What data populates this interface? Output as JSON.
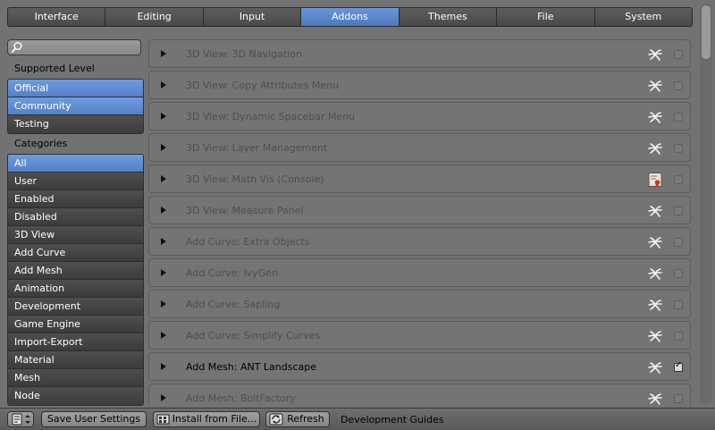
{
  "tabs": [
    "Interface",
    "Editing",
    "Input",
    "Addons",
    "Themes",
    "File",
    "System"
  ],
  "active_tab": "Addons",
  "search": {
    "placeholder": ""
  },
  "supported_level": {
    "label": "Supported Level",
    "items": [
      {
        "label": "Official",
        "selected": true
      },
      {
        "label": "Community",
        "selected": true
      },
      {
        "label": "Testing",
        "selected": false
      }
    ]
  },
  "categories": {
    "label": "Categories",
    "items": [
      {
        "label": "All",
        "selected": true
      },
      {
        "label": "User",
        "selected": false
      },
      {
        "label": "Enabled",
        "selected": false
      },
      {
        "label": "Disabled",
        "selected": false
      },
      {
        "label": "3D View",
        "selected": false
      },
      {
        "label": "Add Curve",
        "selected": false
      },
      {
        "label": "Add Mesh",
        "selected": false
      },
      {
        "label": "Animation",
        "selected": false
      },
      {
        "label": "Development",
        "selected": false
      },
      {
        "label": "Game Engine",
        "selected": false
      },
      {
        "label": "Import-Export",
        "selected": false
      },
      {
        "label": "Material",
        "selected": false
      },
      {
        "label": "Mesh",
        "selected": false
      },
      {
        "label": "Node",
        "selected": false
      }
    ]
  },
  "addons": [
    {
      "name": "3D View: 3D Navigation",
      "icon": "community-icon",
      "enabled": false
    },
    {
      "name": "3D View: Copy Attributes Menu",
      "icon": "community-icon",
      "enabled": false
    },
    {
      "name": "3D View: Dynamic Spacebar Menu",
      "icon": "community-icon",
      "enabled": false
    },
    {
      "name": "3D View: Layer Management",
      "icon": "community-icon",
      "enabled": false
    },
    {
      "name": "3D View: Math Vis (Console)",
      "icon": "official-icon",
      "enabled": false
    },
    {
      "name": "3D View: Measure Panel",
      "icon": "community-icon",
      "enabled": false
    },
    {
      "name": "Add Curve: Extra Objects",
      "icon": "community-icon",
      "enabled": false
    },
    {
      "name": "Add Curve: IvyGen",
      "icon": "community-icon",
      "enabled": false
    },
    {
      "name": "Add Curve: Sapling",
      "icon": "community-icon",
      "enabled": false
    },
    {
      "name": "Add Curve: Simplify Curves",
      "icon": "community-icon",
      "enabled": false
    },
    {
      "name": "Add Mesh: ANT Landscape",
      "icon": "community-icon",
      "enabled": true
    },
    {
      "name": "Add Mesh: BoltFactory",
      "icon": "community-icon",
      "enabled": false
    }
  ],
  "bottom_bar": {
    "save_label": "Save User Settings",
    "install_label": "Install from File...",
    "refresh_label": "Refresh",
    "dev_guides_label": "Development Guides"
  },
  "colors": {
    "accent": "#5580c6",
    "panel_bg": "#727272",
    "list_item_bg": "#444444"
  }
}
